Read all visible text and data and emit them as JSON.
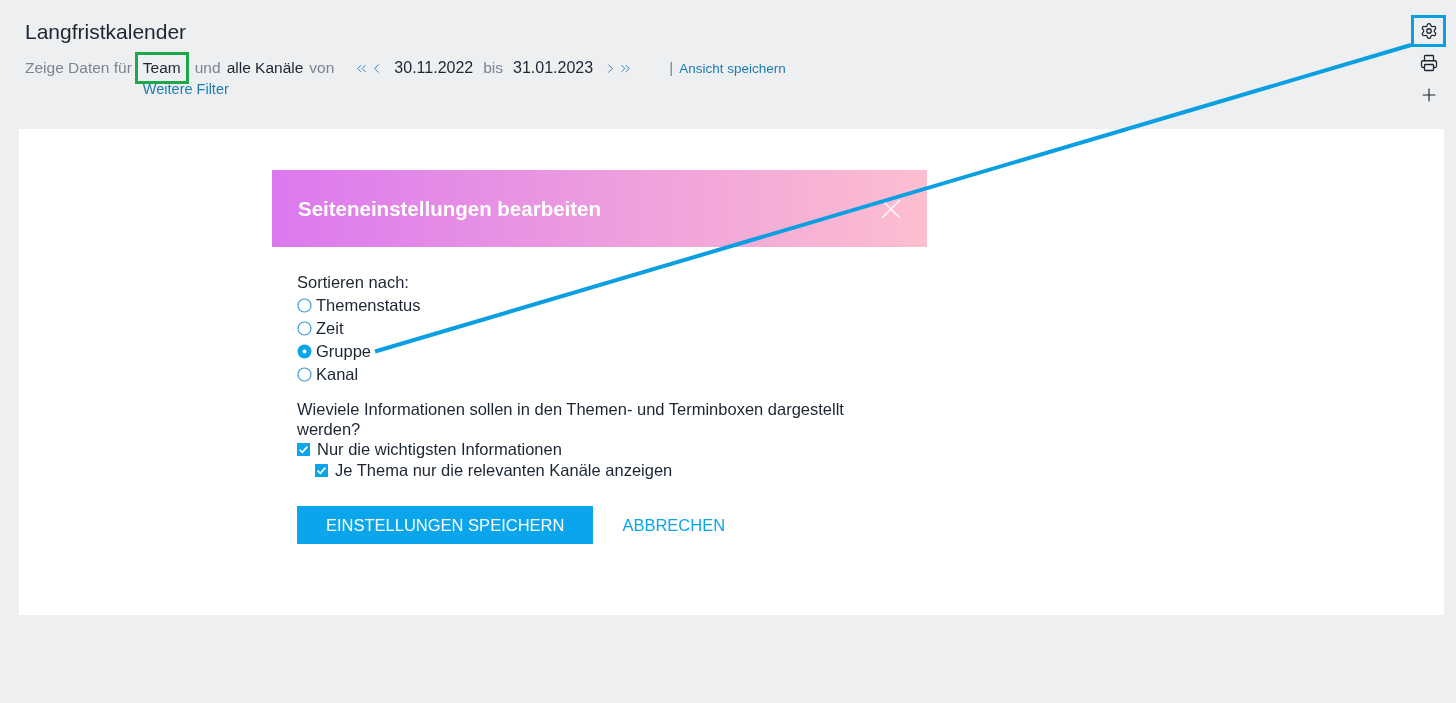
{
  "page": {
    "title": "Langfristkalender"
  },
  "filter_bar": {
    "prefix": "Zeige Daten für",
    "team": {
      "label": "Team",
      "highlighted": true
    },
    "connector": "und",
    "channels": "alle Kanäle",
    "from_label": "von",
    "start_date": "30.11.2022",
    "until_label": "bis",
    "end_date": "31.01.2023",
    "separator": "|",
    "save_view_link": "Ansicht speichern",
    "more_filters_link": "Weitere Filter"
  },
  "toolbar": [
    {
      "kind": "settings",
      "highlighted": true
    },
    {
      "kind": "print",
      "highlighted": false
    },
    {
      "kind": "add",
      "highlighted": false
    }
  ],
  "dialog": {
    "title": "Seiteneinstellungen bearbeiten",
    "sort_label": "Sortieren nach:",
    "sort_options": [
      {
        "label": "Themenstatus",
        "selected": false,
        "pointed_at": false
      },
      {
        "label": "Zeit",
        "selected": false,
        "pointed_at": false
      },
      {
        "label": "Gruppe",
        "selected": true,
        "pointed_at": true
      },
      {
        "label": "Kanal",
        "selected": false,
        "pointed_at": false
      }
    ],
    "info_question": "Wieviele Informationen sollen in den Themen- und Terminboxen dargestellt werden?",
    "checkboxes": [
      {
        "label": "Nur die wichtigsten Informationen",
        "checked": true,
        "children": [
          {
            "label": "Je Thema nur die relevanten Kanäle anzeigen",
            "checked": true
          }
        ]
      }
    ],
    "buttons": [
      {
        "kind": "primary",
        "label": "EINSTELLUNGEN SPEICHERN"
      },
      {
        "kind": "link",
        "label": "ABBRECHEN"
      }
    ]
  }
}
